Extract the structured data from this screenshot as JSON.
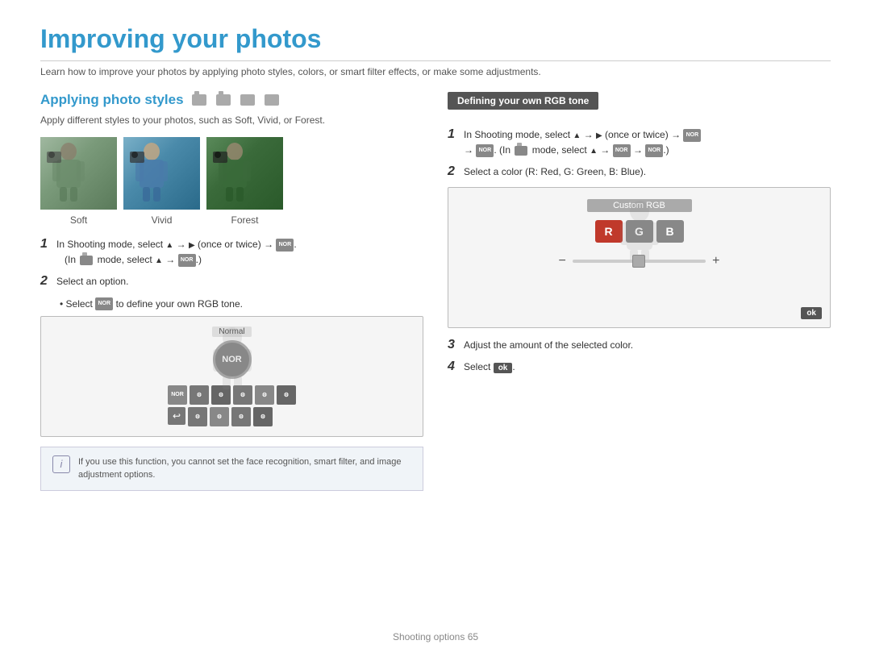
{
  "page": {
    "title": "Improving your photos",
    "subtitle": "Learn how to improve your photos by applying photo styles, colors, or smart filter effects, or make some adjustments.",
    "footer": "Shooting options  65"
  },
  "left": {
    "section_title": "Applying photo styles",
    "section_desc": "Apply different styles to your photos, such as Soft, Vivid, or Forest.",
    "photo_labels": [
      "Soft",
      "Vivid",
      "Forest"
    ],
    "step1_text": "In Shooting mode, select",
    "step1_cont": "(once or twice) →",
    "step1_sub": "(In     mode, select    →     .)",
    "step2_text": "Select an option.",
    "bullet1": "Select     to define your own RGB tone.",
    "ui_normal_label": "Normal",
    "info_text": "If you use this function, you cannot set the face recognition, smart filter, and image adjustment options."
  },
  "right": {
    "rgb_section_title": "Defining your own RGB tone",
    "step1_text": "In Shooting mode, select",
    "step1_detail": "(once or twice) →",
    "step1_sub": "→     . (In     mode, select    →     →     .)",
    "step2_text": "Select a color (R: Red, G: Green, B: Blue).",
    "custom_rgb_label": "Custom RGB",
    "rgb_buttons": [
      "R",
      "G",
      "B"
    ],
    "step3_text": "Adjust the amount of the selected color.",
    "step4_text": "Select",
    "step4_ok": "OK",
    "ok_btn_label": "ok"
  }
}
